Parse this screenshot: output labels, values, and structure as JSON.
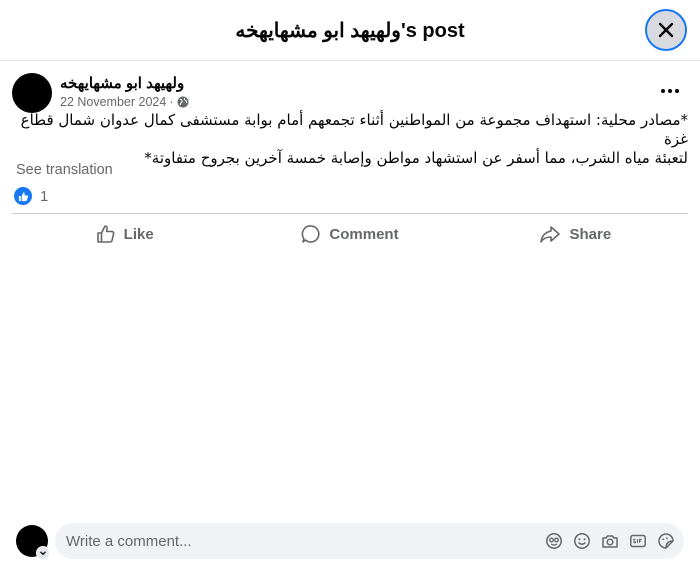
{
  "header": {
    "title": "ولهيهد ابو مشهايهخه's post",
    "close_icon": "close-icon"
  },
  "post": {
    "author": "ولهيهد ابو مشهايهخه",
    "date": "22 November 2024",
    "separator": "·",
    "privacy_icon": "globe-icon",
    "more_icon": "more-horizontal-icon",
    "text_line1": "*مصادر محلية: استهداف مجموعة من المواطنين أثناء تجمعهم أمام بوابة مستشفى كمال عدوان شمال قطاع غزة",
    "text_line2": "لتعبئة مياه الشرب، مما أسفر عن استشهاد مواطن وإصابة خمسة آخرين بجروح متفاوتة*",
    "see_translation": "See translation",
    "reaction_count": "1"
  },
  "actions": {
    "like": "Like",
    "comment": "Comment",
    "share": "Share"
  },
  "comment_box": {
    "placeholder": "Write a comment...",
    "icons": [
      "avatar-sticker-icon",
      "emoji-icon",
      "camera-icon",
      "gif-icon",
      "sticker-icon"
    ]
  },
  "colors": {
    "accent": "#1877f2",
    "secondary_text": "#65676b",
    "close_bg": "#d8dadf",
    "input_bg": "#f0f2f5"
  }
}
